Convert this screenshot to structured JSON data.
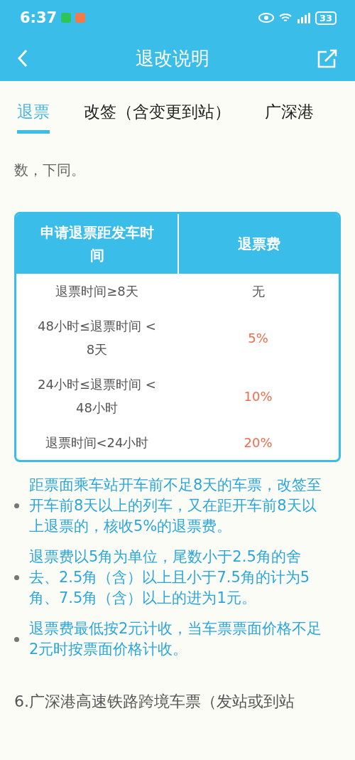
{
  "status_bar": {
    "time": "6:37",
    "battery": "33"
  },
  "nav": {
    "title": "退改说明"
  },
  "tabs": [
    {
      "label": "退票",
      "selected": true
    },
    {
      "label": "改签（含变更到站）",
      "selected": false
    },
    {
      "label": "广深港",
      "selected": false
    }
  ],
  "intro": [
    "数，下同。"
  ],
  "table": {
    "columns": [
      "申请退票距发车时间",
      "退票费"
    ],
    "rows": [
      {
        "time": "退票时间≥8天",
        "fee": "无",
        "highlight": false
      },
      {
        "time": "48小时≤退票时间 < 8天",
        "fee": "5%",
        "highlight": true
      },
      {
        "time": "24小时≤退票时间 < 48小时",
        "fee": "10%",
        "highlight": true
      },
      {
        "time": "退票时间<24小时",
        "fee": "20%",
        "highlight": true
      }
    ]
  },
  "notes": [
    "距票面乘车站开车前不足8天的车票，改签至开车前8天以上的列车，又在距开车前8天以上退票的，核收5%的退票费。",
    "退票费以5角为单位，尾数小于2.5角的舍去、2.5角（含）以上且小于7.5角的计为5角、7.5角（含）以上的进为1元。",
    "退票费最低按2元计收，当车票票面价格不足2元时按票面价格计收。"
  ],
  "section": "6.广深港高速铁路跨境车票（发站或到站"
}
